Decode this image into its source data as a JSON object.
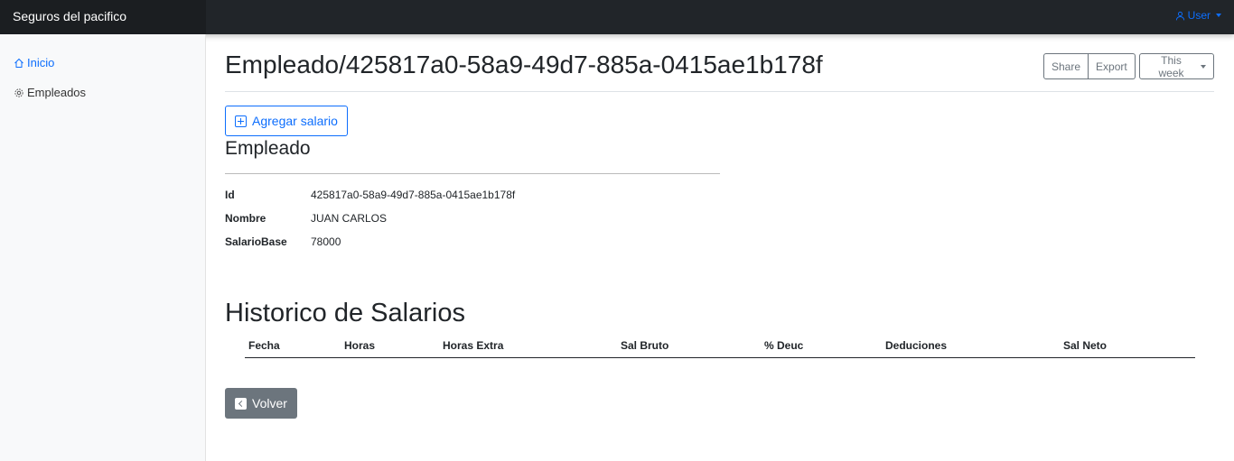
{
  "app": {
    "brand": "Seguros del pacifico"
  },
  "header": {
    "user_label": "User"
  },
  "sidebar": {
    "items": [
      {
        "label": "Inicio",
        "icon": "home-icon",
        "active": true
      },
      {
        "label": "Empleados",
        "icon": "gear-icon",
        "active": false
      }
    ]
  },
  "page": {
    "title": "Empleado/425817a0-58a9-49d7-885a-0415ae1b178f",
    "toolbar": {
      "share_label": "Share",
      "export_label": "Export",
      "period_label": "This week"
    },
    "add_salary_label": "Agregar salario"
  },
  "employee": {
    "section_title": "Empleado",
    "fields": [
      {
        "label": "Id",
        "value": "425817a0-58a9-49d7-885a-0415ae1b178f"
      },
      {
        "label": "Nombre",
        "value": "JUAN CARLOS"
      },
      {
        "label": "SalarioBase",
        "value": "78000"
      }
    ]
  },
  "history": {
    "title": "Historico de Salarios",
    "columns": [
      "Fecha",
      "Horas",
      "Horas Extra",
      "Sal Bruto",
      "% Deuc",
      "Deduciones",
      "Sal Neto"
    ],
    "rows": []
  },
  "back_label": "Volver",
  "colors": {
    "primary": "#0d6efd",
    "secondary": "#6c757d",
    "navbar": "#212529"
  }
}
